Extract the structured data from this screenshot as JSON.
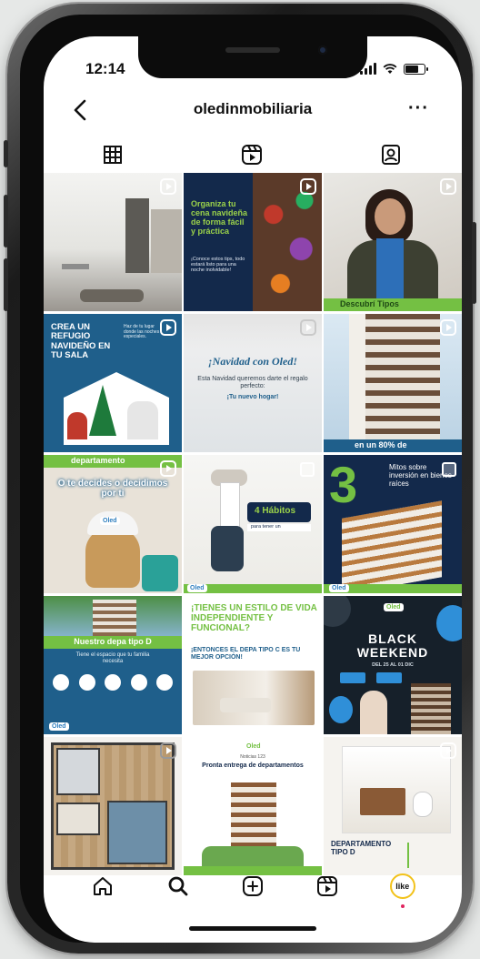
{
  "status": {
    "time": "12:14"
  },
  "header": {
    "username": "oledinmobiliaria",
    "more": "···"
  },
  "tabs": [
    {
      "icon": "grid-icon"
    },
    {
      "icon": "reels-icon"
    },
    {
      "icon": "tagged-icon"
    }
  ],
  "posts": {
    "p2": {
      "title": "Organiza tu cena navideña de forma fácil y práctica",
      "body": "¡Conoce estos tips, todo estará listo para una noche inolvidable!"
    },
    "p3": {
      "caption": "Descubrí Tipos"
    },
    "p4": {
      "title": "CREA UN REFUGIO NAVIDEÑO EN TU SALA",
      "side": "Haz de tu lugar donde las noches especiales."
    },
    "p5": {
      "title": "¡Navidad con Oled!",
      "body": "Esta Navidad queremos darte el regalo perfecto:",
      "accent": "¡Tu nuevo hogar!"
    },
    "p6": {
      "caption": "en un 80% de"
    },
    "p7": {
      "tag": "departamento",
      "title": "O te decides o decidimos por ti",
      "logo": "Oled"
    },
    "p8": {
      "badge": "4 Hábitos",
      "sub": "para tener un",
      "logo": "Oled"
    },
    "p9": {
      "number": "3",
      "title": "Mitos sobre inversión en bienes raíces",
      "logo": "Oled"
    },
    "p10": {
      "title": "Nuestro depa tipo D",
      "body": "Tiene el espacio que tu familia necesita",
      "logo": "Oled"
    },
    "p11": {
      "title": "¡TIENES UN ESTILO DE VIDA INDEPENDIENTE Y FUNCIONAL?",
      "body": "¡ENTONCES EL DEPA TIPO C ES TU MEJOR OPCIÓN!"
    },
    "p12": {
      "line1": "BLACK",
      "line2": "WEEKEND",
      "dates": "DEL 25 AL 01 DIC",
      "logo": "Oled"
    },
    "p14": {
      "small": "Noticias 123",
      "title": "Pronta entrega de departamentos"
    },
    "p15": {
      "title": "DEPARTAMENTO TIPO D"
    }
  },
  "nav": [
    {
      "icon": "home-icon"
    },
    {
      "icon": "search-icon"
    },
    {
      "icon": "new-post-icon"
    },
    {
      "icon": "reels-nav-icon"
    },
    {
      "icon": "profile-avatar-icon",
      "label": "like"
    }
  ],
  "colors": {
    "brand_blue": "#1f5f8b",
    "brand_green": "#74c043",
    "navy": "#13294b"
  }
}
